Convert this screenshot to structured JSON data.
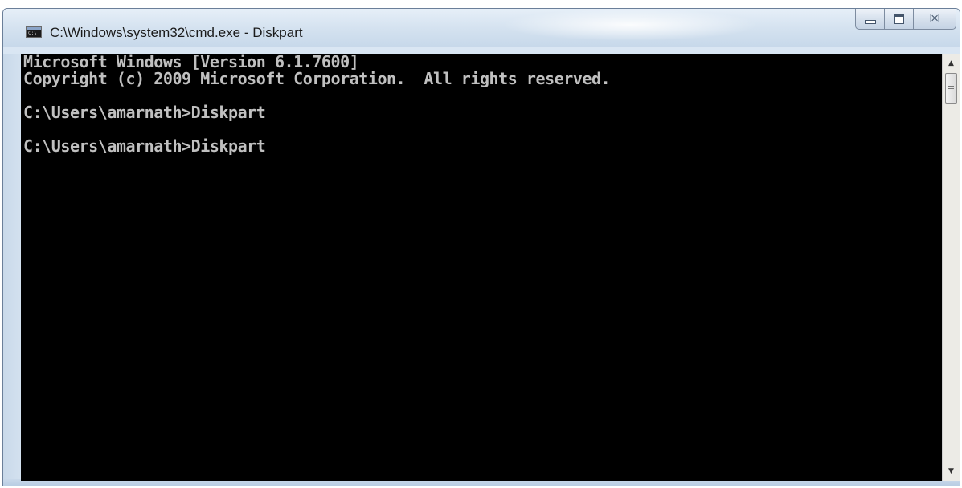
{
  "window": {
    "title": "C:\\Windows\\system32\\cmd.exe - Diskpart",
    "icon": "command-prompt-icon",
    "icon_text": "C:\\",
    "controls": {
      "minimize": "minimize-icon",
      "maximize": "maximize-icon",
      "close": "close-icon",
      "close_glyph": "☒"
    }
  },
  "console": {
    "lines": [
      "Microsoft Windows [Version 6.1.7600]",
      "Copyright (c) 2009 Microsoft Corporation.  All rights reserved.",
      "",
      "C:\\Users\\amarnath>Diskpart",
      "",
      "C:\\Users\\amarnath>Diskpart"
    ],
    "background": "#000000",
    "foreground": "#c0c0c0"
  },
  "scrollbar": {
    "up_arrow": "▲",
    "down_arrow": "▼"
  }
}
